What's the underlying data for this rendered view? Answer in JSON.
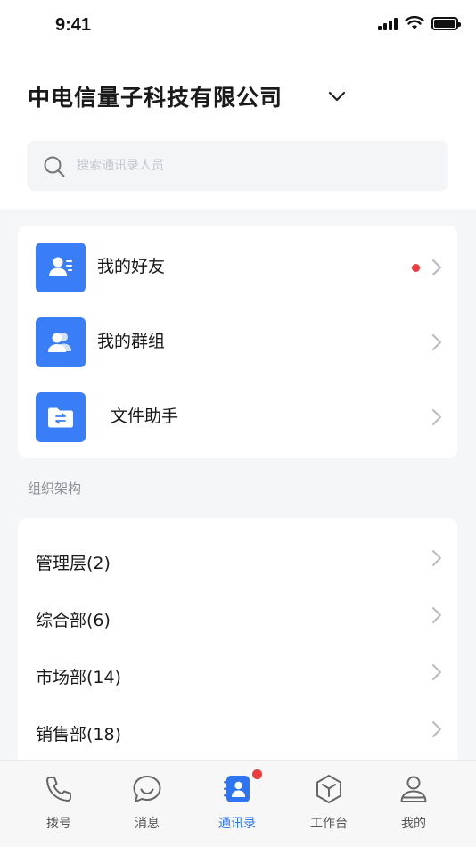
{
  "status_bar": {
    "time": "9:41"
  },
  "header": {
    "company_name": "中电信量子科技有限公司"
  },
  "search": {
    "placeholder": "搜索通讯录人员"
  },
  "quick_links": [
    {
      "label": "我的好友",
      "icon": "friends-icon",
      "has_badge": true
    },
    {
      "label": "我的群组",
      "icon": "group-icon",
      "has_badge": false
    },
    {
      "label": "文件助手",
      "icon": "file-transfer-icon",
      "has_badge": false
    }
  ],
  "org_section": {
    "title": "组织架构",
    "departments": [
      {
        "label": "管理层(2)"
      },
      {
        "label": "综合部(6)"
      },
      {
        "label": "市场部(14)"
      },
      {
        "label": "销售部(18)"
      }
    ]
  },
  "tabbar": {
    "tabs": [
      {
        "label": "拨号",
        "icon": "phone-icon",
        "active": false
      },
      {
        "label": "消息",
        "icon": "message-icon",
        "active": false
      },
      {
        "label": "通讯录",
        "icon": "contacts-icon",
        "active": true,
        "badge": true
      },
      {
        "label": "工作台",
        "icon": "workbench-icon",
        "active": false
      },
      {
        "label": "我的",
        "icon": "profile-icon",
        "active": false
      }
    ]
  },
  "colors": {
    "accent": "#3a7ef7",
    "badge": "#ef3b3b",
    "background": "#f5f6f8"
  }
}
